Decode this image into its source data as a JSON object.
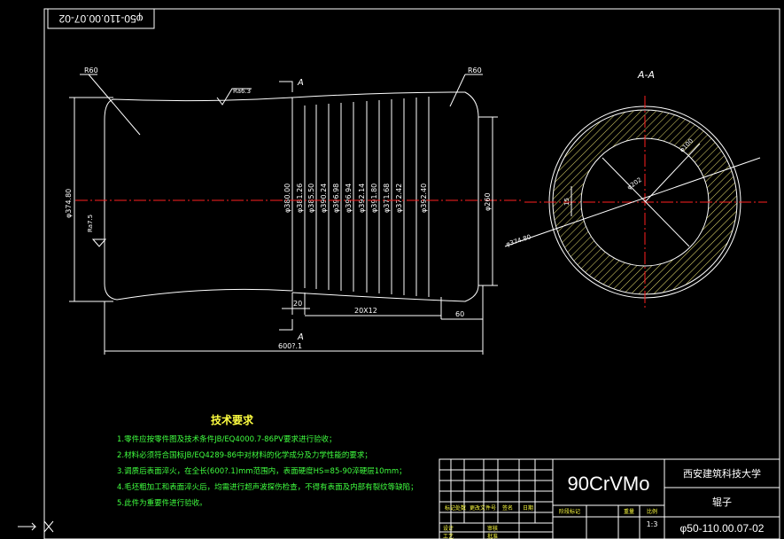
{
  "drawing_number_rotated": "φ50-110.00.07-02",
  "section": {
    "cut_label_top": "A",
    "cut_label_bottom": "A",
    "view_title": "A-A"
  },
  "radii": {
    "left": "R60",
    "right": "R60"
  },
  "surface_finish": {
    "top": "Ra6.3",
    "left": "Ra7.5"
  },
  "dims": {
    "left_height": "φ374.80",
    "right_height": "φ260",
    "step_width": "20",
    "pitch": "20X12",
    "end_width": "60",
    "total_length": "600?.1",
    "stations": [
      "φ380.00",
      "φ381.26",
      "φ385.50",
      "φ390.24",
      "φ396.98",
      "φ396.94",
      "φ392.14",
      "φ391.80",
      "φ371.68",
      "φ372.42",
      "φ392.40"
    ]
  },
  "section_dims": {
    "outer": "φ374.80",
    "inner": "φ100",
    "mid": "φ202",
    "key": "15"
  },
  "tech_req": {
    "title": "技术要求",
    "items": [
      "1.零件应按零件图及技术条件JB/EQ4000.7-86PV要求进行验收；",
      "2.材料必须符合国标JB/EQ4289-86中对材料的化学成分及力学性能的要求；",
      "3.调质后表面淬火，在全长(600?.1)mm范围内，表面硬度HS=85-90淬硬层10mm；",
      "4.毛坯粗加工和表面淬火后，均需进行超声波探伤检查，不得有表面及内部有裂纹等缺陷；",
      "5.此件为重要件进行验收。"
    ]
  },
  "title_block": {
    "material": "90CrVMo",
    "school": "西安建筑科技大学",
    "part_name": "辊子",
    "drawing_number": "φ50-110.00.07-02",
    "scale": "1:3",
    "headers": [
      "标记",
      "处数",
      "更改文件号",
      "签名",
      "日期"
    ],
    "meta_labels": [
      "阶段标记",
      "重量",
      "比例"
    ],
    "bottom_labels": [
      "设计",
      "审核",
      "工艺",
      "批准"
    ]
  },
  "colors": {
    "frame": "#ffffff",
    "dim": "#ffffff",
    "center": "#ff2020",
    "hatch": "#e8e070",
    "text_green": "#40ff40",
    "text_yellow": "#ffff40"
  }
}
